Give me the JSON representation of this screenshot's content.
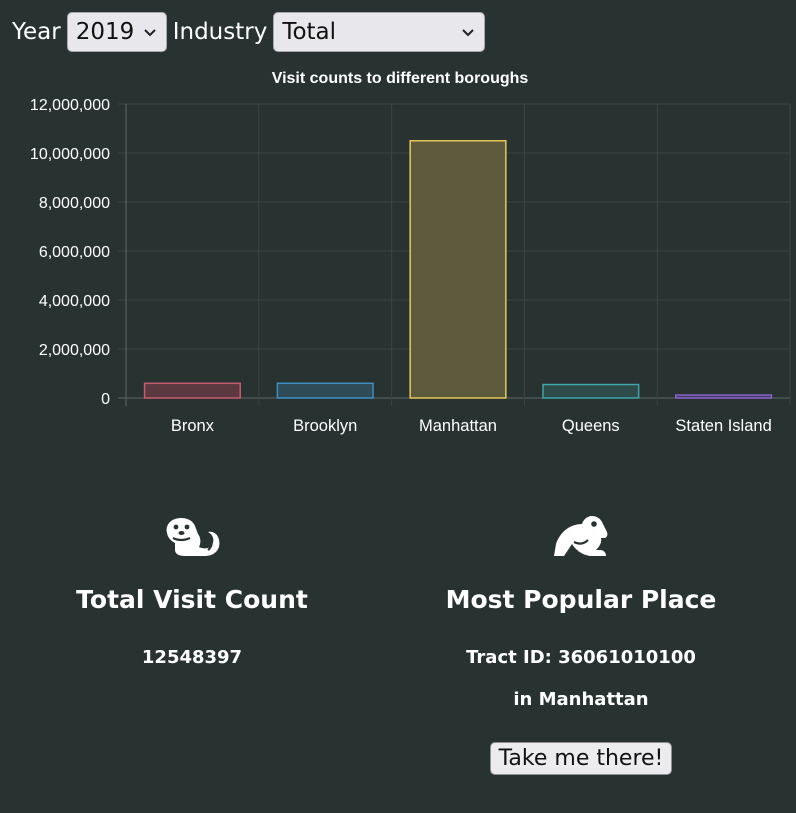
{
  "controls": {
    "year_label": "Year",
    "year_value": "2019",
    "industry_label": "Industry",
    "industry_value": "Total"
  },
  "chart_data": {
    "type": "bar",
    "title": "Visit counts to different boroughs",
    "categories": [
      "Bronx",
      "Brooklyn",
      "Manhattan",
      "Queens",
      "Staten Island"
    ],
    "values": [
      600000,
      600000,
      10500000,
      550000,
      120000
    ],
    "ylim": [
      0,
      12000000
    ],
    "yticks": [
      "0",
      "2,000,000",
      "4,000,000",
      "6,000,000",
      "8,000,000",
      "10,000,000",
      "12,000,000"
    ],
    "grid": true,
    "colors": [
      "#c75b6e",
      "#3f8fc4",
      "#e6c75a",
      "#3fa6a8",
      "#8a63d2"
    ],
    "fills": [
      "#5a3a40",
      "#2e4b57",
      "#5d5a3e",
      "#2f4a4a",
      "#3f3c55"
    ]
  },
  "stats": {
    "total_icon": "otter-icon",
    "total_title": "Total Visit Count",
    "total_value": "12548397",
    "popular_icon": "frog-icon",
    "popular_title": "Most Popular Place",
    "tract_line": "Tract ID: 36061010100",
    "borough_line": "in Manhattan",
    "button_label": "Take me there!"
  }
}
